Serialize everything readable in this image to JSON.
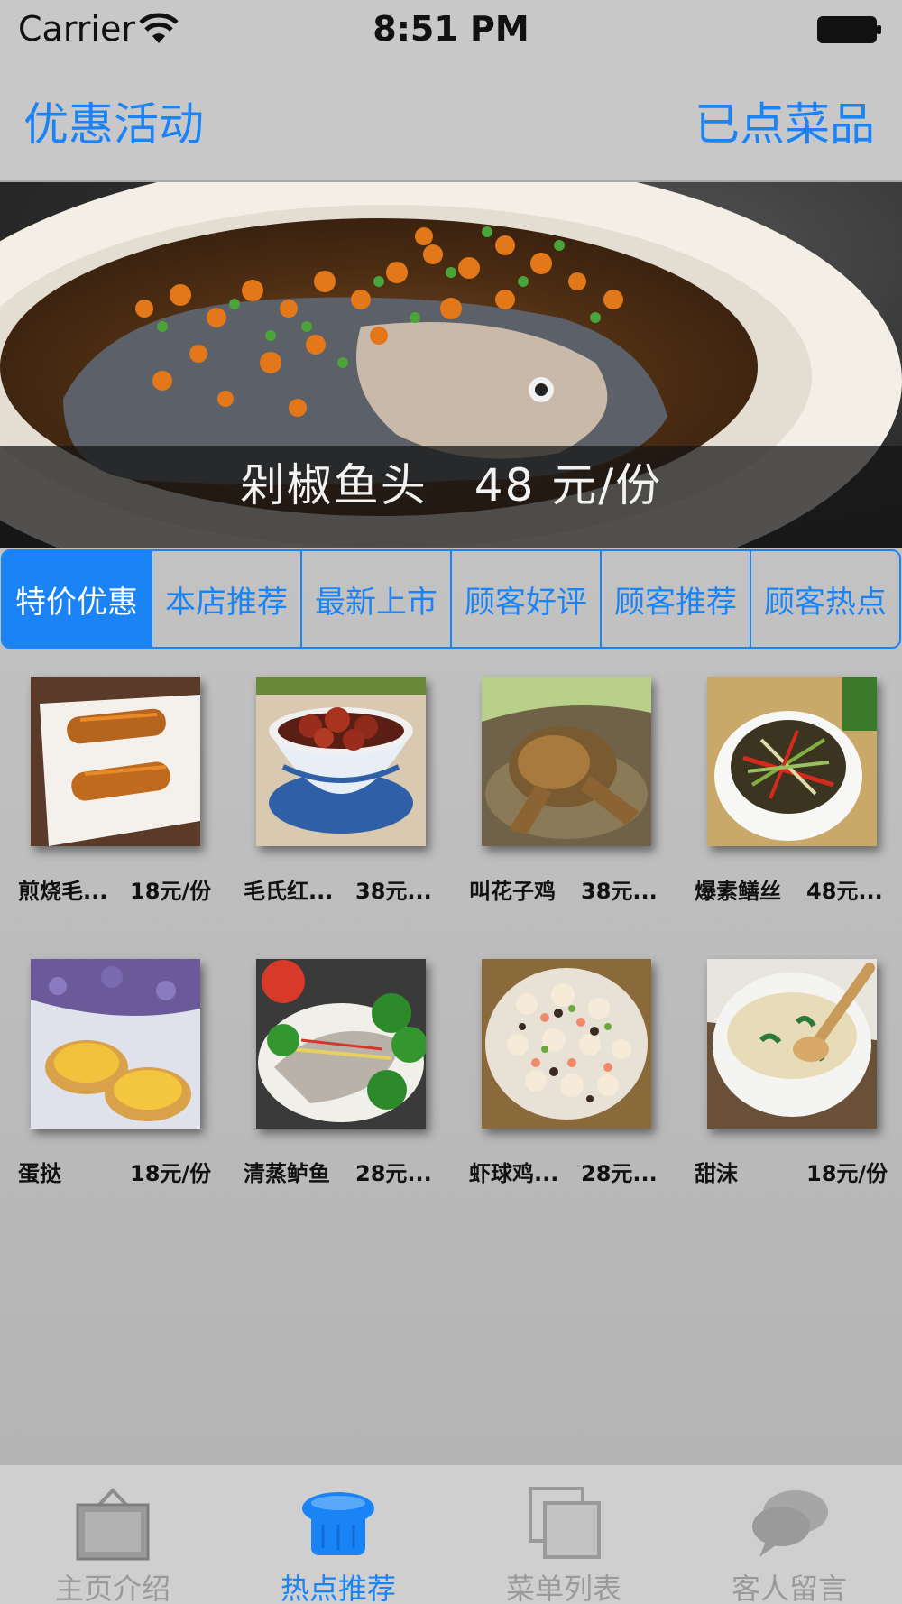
{
  "status_bar": {
    "carrier": "Carrier",
    "time": "8:51 PM"
  },
  "nav": {
    "left_button": "优惠活动",
    "right_button": "已点菜品"
  },
  "banner": {
    "caption": "剁椒鱼头　48 元/份",
    "page_count": 5,
    "current_page": 1
  },
  "segments": [
    "特价优惠",
    "本店推荐",
    "最新上市",
    "顾客好评",
    "顾客推荐",
    "顾客热点"
  ],
  "selected_segment": 0,
  "dishes": [
    {
      "name": "煎烧毛...",
      "price": "18元/份",
      "icon": "fried-fish-roll-image"
    },
    {
      "name": "毛氏红...",
      "price": "38元...",
      "icon": "braised-pork-image"
    },
    {
      "name": "叫花子鸡",
      "price": "38元...",
      "icon": "beggars-chicken-image"
    },
    {
      "name": "爆素鳝丝",
      "price": "48元...",
      "icon": "stir-fried-shreds-image"
    },
    {
      "name": "蛋挞",
      "price": "18元/份",
      "icon": "egg-tart-image"
    },
    {
      "name": "清蒸鲈鱼",
      "price": "28元...",
      "icon": "steamed-perch-image"
    },
    {
      "name": "虾球鸡...",
      "price": "28元...",
      "icon": "shrimp-chicken-image"
    },
    {
      "name": "甜沫",
      "price": "18元/份",
      "icon": "sweet-porridge-image"
    }
  ],
  "tabs": [
    {
      "label": "主页介绍",
      "icon": "shopping-bag-icon"
    },
    {
      "label": "热点推荐",
      "icon": "chef-hat-icon"
    },
    {
      "label": "菜单列表",
      "icon": "copy-pages-icon"
    },
    {
      "label": "客人留言",
      "icon": "chat-bubbles-icon"
    }
  ],
  "active_tab": 1,
  "colors": {
    "accent": "#1a84f6",
    "background": "#c4c4c4",
    "inactive_tab": "#9a9a9a"
  }
}
